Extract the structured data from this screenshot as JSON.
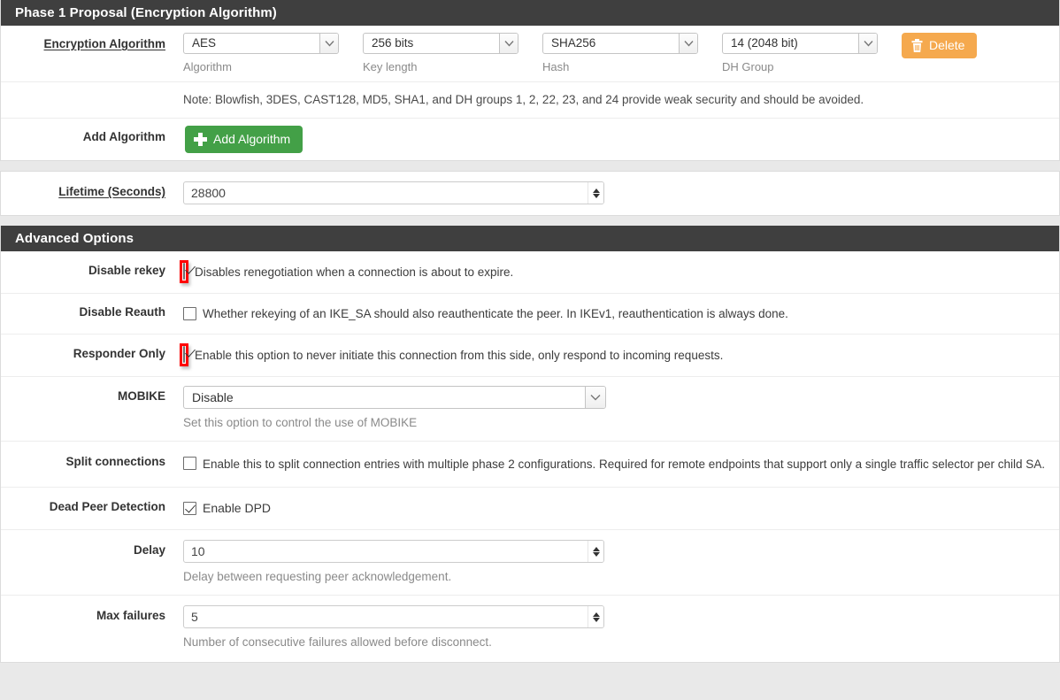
{
  "phase1": {
    "title": "Phase 1 Proposal (Encryption Algorithm)",
    "encryption_label": "Encryption Algorithm",
    "algorithm": {
      "value": "AES",
      "caption": "Algorithm"
    },
    "key_length": {
      "value": "256 bits",
      "caption": "Key length"
    },
    "hash": {
      "value": "SHA256",
      "caption": "Hash"
    },
    "dh_group": {
      "value": "14 (2048 bit)",
      "caption": "DH Group"
    },
    "delete_button": "Delete",
    "note": "Note: Blowfish, 3DES, CAST128, MD5, SHA1, and DH groups 1, 2, 22, 23, and 24 provide weak security and should be avoided.",
    "add_algorithm_label": "Add Algorithm",
    "add_algorithm_button": "Add Algorithm",
    "lifetime_label": "Lifetime (Seconds)",
    "lifetime_value": "28800"
  },
  "advanced": {
    "title": "Advanced Options",
    "disable_rekey": {
      "label": "Disable rekey",
      "checked": true,
      "highlighted": true,
      "text": "Disables renegotiation when a connection is about to expire."
    },
    "disable_reauth": {
      "label": "Disable Reauth",
      "checked": false,
      "highlighted": false,
      "text": "Whether rekeying of an IKE_SA should also reauthenticate the peer. In IKEv1, reauthentication is always done."
    },
    "responder_only": {
      "label": "Responder Only",
      "checked": true,
      "highlighted": true,
      "text": "Enable this option to never initiate this connection from this side, only respond to incoming requests."
    },
    "mobike": {
      "label": "MOBIKE",
      "value": "Disable",
      "help": "Set this option to control the use of MOBIKE"
    },
    "split_connections": {
      "label": "Split connections",
      "checked": false,
      "text": "Enable this to split connection entries with multiple phase 2 configurations. Required for remote endpoints that support only a single traffic selector per child SA."
    },
    "dead_peer_detection": {
      "label": "Dead Peer Detection",
      "checked": true,
      "text": "Enable DPD"
    },
    "delay": {
      "label": "Delay",
      "value": "10",
      "help": "Delay between requesting peer acknowledgement."
    },
    "max_failures": {
      "label": "Max failures",
      "value": "5",
      "help": "Number of consecutive failures allowed before disconnect."
    }
  },
  "colors": {
    "header_bar": "#3f3f3f",
    "delete_button": "#f5a94e",
    "add_button": "#43a047",
    "annotation": "#ff0000"
  }
}
